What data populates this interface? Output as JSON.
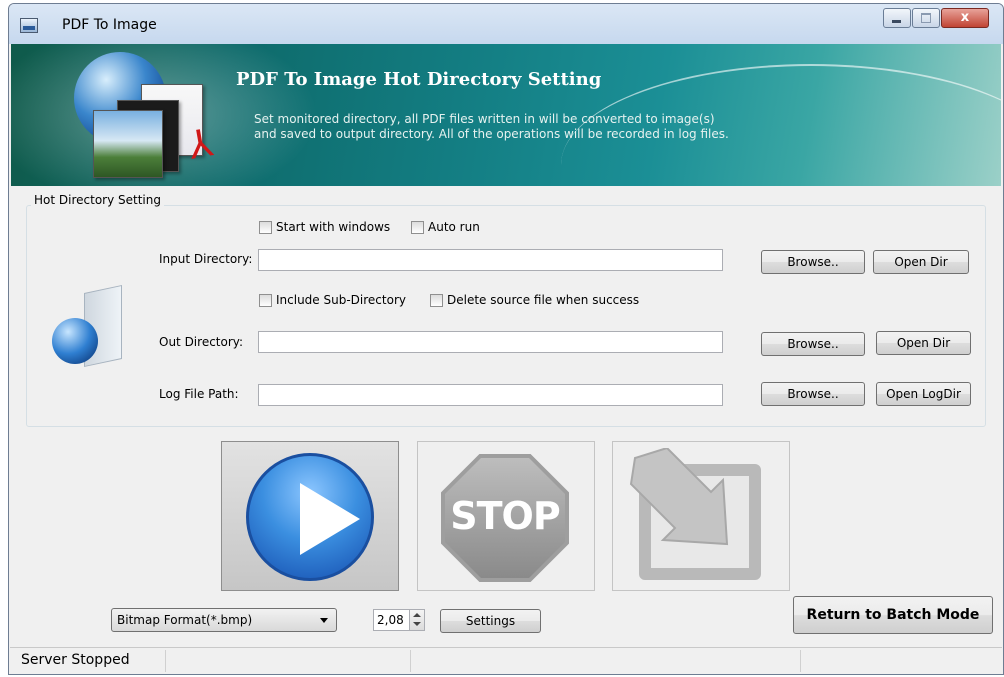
{
  "window": {
    "title": "PDF To Image",
    "controls": {
      "close_label": "x"
    }
  },
  "banner": {
    "title": "PDF To Image Hot Directory Setting",
    "description_line1": "Set monitored directory, all PDF files written in will be converted to image(s)",
    "description_line2": "and saved to output directory. All of the operations will be recorded in log files."
  },
  "group": {
    "label": "Hot Directory Setting",
    "start_with_windows": "Start with windows",
    "auto_run": "Auto run",
    "input_directory_label": "Input Directory:",
    "include_subdir": "Include Sub-Directory",
    "delete_source": "Delete source file when success",
    "out_directory_label": "Out Directory:",
    "log_file_label": "Log File Path:",
    "browse_label": "Browse..",
    "open_dir_label": "Open Dir",
    "open_logdir_label": "Open LogDir",
    "input_value": "",
    "out_value": "",
    "log_value": ""
  },
  "actions": {
    "stop_label": "STOP"
  },
  "bottom": {
    "format_selected": "Bitmap Format(*.bmp)",
    "spin_value": "2,08",
    "settings_label": "Settings",
    "return_label": "Return to Batch Mode"
  },
  "status": {
    "text": "Server Stopped"
  },
  "colors": {
    "banner_accent": "#137d82",
    "play_blue": "#3b8fe0",
    "stop_gray": "#9e9e9e"
  },
  "icons": [
    "app-icon",
    "globe-icon",
    "document-stack-icon",
    "pdf-icon",
    "folder-globe-icon",
    "play-icon",
    "stop-icon",
    "return-arrow-icon",
    "chevron-down-icon"
  ]
}
